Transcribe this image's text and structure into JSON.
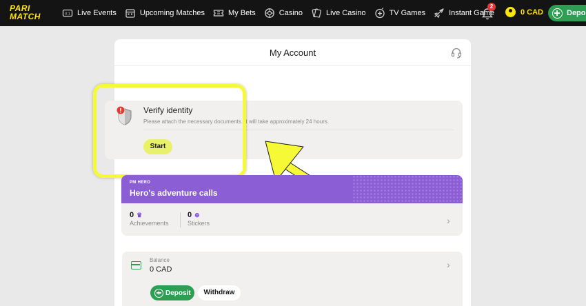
{
  "brand": {
    "logo_line1": "PARI",
    "logo_line2": "MATCH",
    "accent": "#ffe600"
  },
  "nav": {
    "items": [
      {
        "label": "Live Events",
        "icon": "live-events-icon"
      },
      {
        "label": "Upcoming Matches",
        "icon": "calendar-icon"
      },
      {
        "label": "My Bets",
        "icon": "ticket-icon"
      },
      {
        "label": "Casino",
        "icon": "roulette-icon"
      },
      {
        "label": "Live Casino",
        "icon": "cards-icon"
      },
      {
        "label": "TV Games",
        "icon": "tv-games-icon"
      },
      {
        "label": "Instant Game",
        "icon": "plane-icon"
      }
    ],
    "notifications_count": "2",
    "balance": "0 CAD",
    "deposit_label": "Deposit"
  },
  "account": {
    "title": "My Account",
    "verify": {
      "title": "Verify identity",
      "description": "Please attach the necessary documents. It will take approximately 24 hours.",
      "start_label": "Start"
    },
    "hero": {
      "kicker": "PM HERO",
      "title": "Hero's adventure calls",
      "achievements_value": "0",
      "achievements_label": "Achievements",
      "stickers_value": "0",
      "stickers_label": "Stickers"
    },
    "balance": {
      "label": "Balance",
      "value": "0 CAD",
      "deposit_label": "Deposit",
      "withdraw_label": "Withdraw"
    }
  },
  "colors": {
    "highlight": "#f6f935",
    "green": "#2e9e54",
    "purple": "#8c5ed6"
  }
}
